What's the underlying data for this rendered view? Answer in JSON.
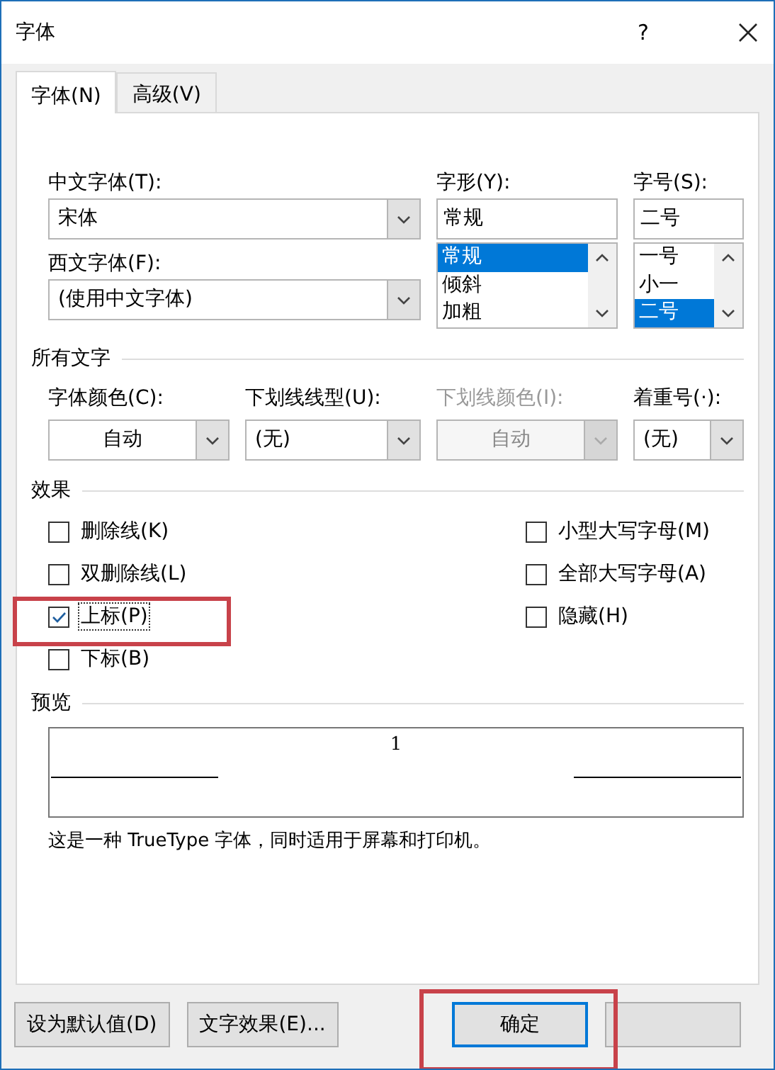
{
  "window": {
    "title": "字体",
    "help": "?"
  },
  "tabs": [
    {
      "label": "字体(N)",
      "selected": true
    },
    {
      "label": "高级(V)",
      "selected": false
    }
  ],
  "chinese_font": {
    "label": "中文字体(T):",
    "value": "宋体"
  },
  "western_font": {
    "label": "西文字体(F):",
    "value": "(使用中文字体)"
  },
  "style": {
    "label": "字形(Y):",
    "value": "常规",
    "options": [
      {
        "label": "常规",
        "selected": true
      },
      {
        "label": "倾斜",
        "selected": false
      },
      {
        "label": "加粗",
        "selected": false
      }
    ]
  },
  "size": {
    "label": "字号(S):",
    "value": "二号",
    "options": [
      {
        "label": "一号",
        "selected": false
      },
      {
        "label": "小一",
        "selected": false
      },
      {
        "label": "二号",
        "selected": true
      }
    ]
  },
  "all_text": {
    "title": "所有文字",
    "fields": [
      {
        "label": "字体颜色(C):",
        "value": "自动",
        "kind": "color",
        "disabled": false
      },
      {
        "label": "下划线线型(U):",
        "value": "(无)",
        "kind": "list",
        "disabled": false
      },
      {
        "label": "下划线颜色(I):",
        "value": "自动",
        "kind": "color",
        "disabled": true
      },
      {
        "label": "着重号(·):",
        "value": "(无)",
        "kind": "list",
        "disabled": false
      }
    ]
  },
  "effects": {
    "title": "效果",
    "left": [
      {
        "label": "删除线(K)",
        "checked": false,
        "focused": false,
        "highlighted": false
      },
      {
        "label": "双删除线(L)",
        "checked": false,
        "focused": false,
        "highlighted": false
      },
      {
        "label": "上标(P)",
        "checked": true,
        "focused": true,
        "highlighted": true
      },
      {
        "label": "下标(B)",
        "checked": false,
        "focused": false,
        "highlighted": false
      }
    ],
    "right": [
      {
        "label": "小型大写字母(M)",
        "checked": false,
        "focused": false,
        "highlighted": false
      },
      {
        "label": "全部大写字母(A)",
        "checked": false,
        "focused": false,
        "highlighted": false
      },
      {
        "label": "隐藏(H)",
        "checked": false,
        "focused": false,
        "highlighted": false
      }
    ]
  },
  "preview": {
    "title": "预览",
    "sample": "1",
    "description": "这是一种 TrueType 字体，同时适用于屏幕和打印机。"
  },
  "buttons": [
    {
      "label": "设为默认值(D)",
      "default": false,
      "highlighted": false
    },
    {
      "label": "文字效果(E)...",
      "default": false,
      "highlighted": false
    },
    {
      "label": "确定",
      "default": true,
      "highlighted": true
    }
  ]
}
